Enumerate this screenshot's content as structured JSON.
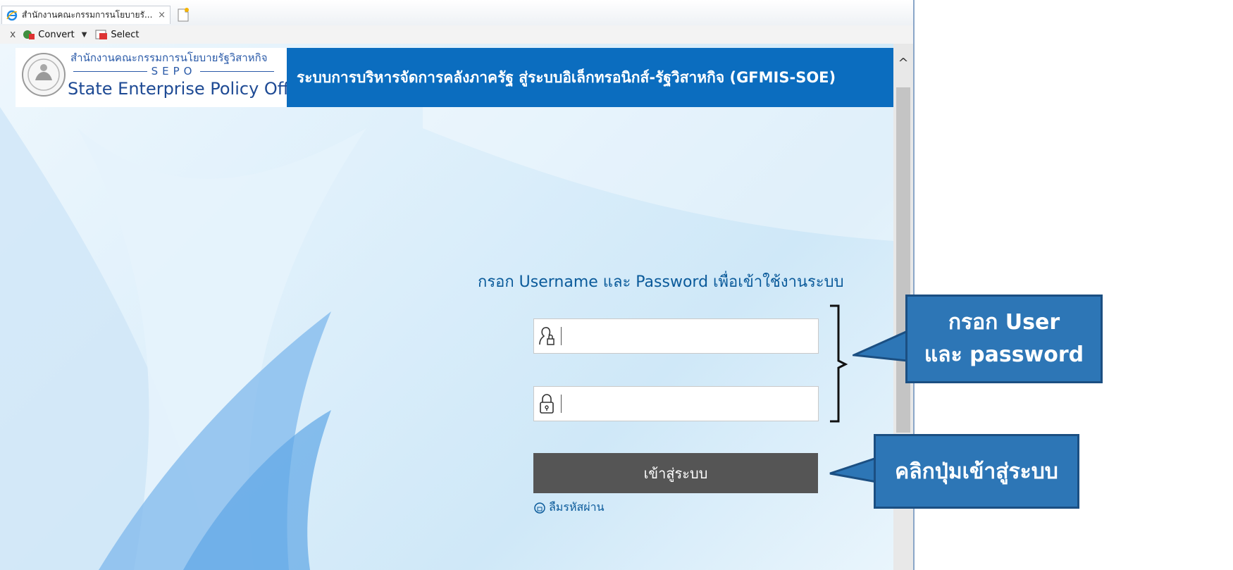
{
  "browser": {
    "tab_title": "สำนักงานคณะกรรมการนโยบายรั...",
    "tab_close": "×",
    "toolbar": {
      "close": "x",
      "convert_label": "Convert",
      "select_label": "Select"
    }
  },
  "header": {
    "logo_thai": "สำนักงานคณะกรรมการนโยบายรัฐวิสาหกิจ",
    "logo_abbr": "SEPO",
    "logo_english": "State Enterprise Policy Office",
    "title": "ระบบการบริหารจัดการคลังภาครัฐ สู่ระบบอิเล็กทรอนิกส์-รัฐวิสาหกิจ (GFMIS-SOE)"
  },
  "login": {
    "prompt": "กรอก Username และ Password เพื่อเข้าใช้งานระบบ",
    "username_value": "",
    "password_value": "",
    "button_label": "เข้าสู่ระบบ",
    "forgot_label": "ลืมรหัสผ่าน"
  },
  "annotations": {
    "callout_1_line1": "กรอก User",
    "callout_1_line2": "และ password",
    "callout_2": "คลิกปุ่มเข้าสู่ระบบ"
  },
  "colors": {
    "header_blue": "#0b6dbf",
    "button_gray": "#555555",
    "callout_blue": "#2d76b6",
    "prompt_blue": "#0a5a9a"
  },
  "icons": [
    "ie-icon",
    "new-tab-icon",
    "convert-icon",
    "select-icon",
    "seal-logo-icon",
    "user-lock-icon",
    "padlock-icon",
    "forgot-icon",
    "scroll-up-icon"
  ]
}
